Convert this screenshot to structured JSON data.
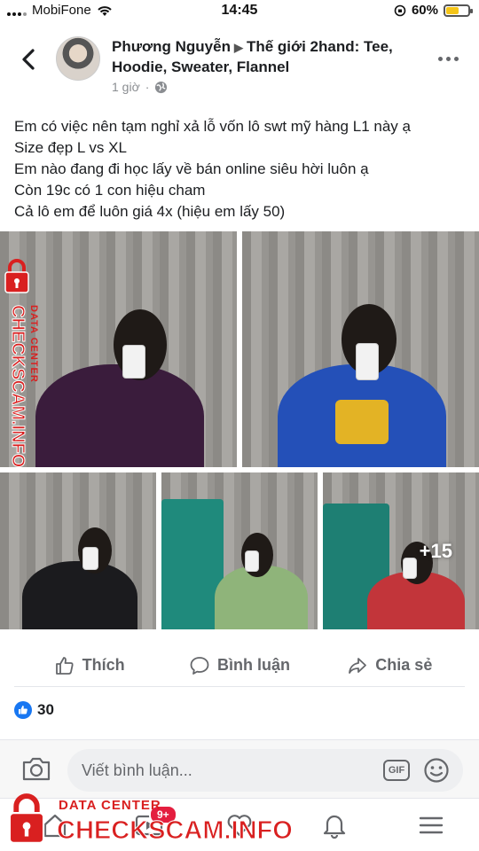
{
  "status_bar": {
    "carrier": "MobiFone",
    "time": "14:45",
    "battery_percent": "60%",
    "battery_level": 0.6
  },
  "header": {
    "author_name": "Phương Nguyễn",
    "group_name": "Thế giới 2hand: Tee, Hoodie, Sweater, Flannel",
    "time_ago": "1 giờ",
    "separator": "·"
  },
  "post": {
    "lines": [
      "Em có việc nên tạm nghỉ xả lỗ vốn lô swt mỹ hàng L1 này ạ",
      "Size đẹp L vs XL",
      "Em nào đang đi học lấy về bán online siêu hời luôn ạ",
      "Còn 19c có 1 con hiệu cham",
      "Cả lô em để luôn giá 4x (hiệu em lấy 50)"
    ],
    "more_photos": "+15"
  },
  "actions": {
    "like": "Thích",
    "comment": "Bình luận",
    "share": "Chia sẻ"
  },
  "reactions": {
    "count": "30"
  },
  "comment_bar": {
    "placeholder": "Viết bình luận...",
    "gif_label": "GIF"
  },
  "bottom_nav": {
    "video_badge": "9+"
  },
  "watermark": {
    "brand": "CHECKSCAM.INFO",
    "tag": "DATA CENTER"
  },
  "colors": {
    "accent": "#1877f2",
    "watermark_red": "#d92020",
    "badge_red": "#e41e3f",
    "muted_text": "#65676b"
  },
  "icons": {
    "back": "chevron-left-icon",
    "more": "more-horizontal-icon",
    "globe": "globe-icon",
    "like": "thumbs-up-icon",
    "comment": "comment-bubble-icon",
    "share": "share-arrow-icon",
    "camera": "camera-icon",
    "emoji": "smiley-icon",
    "lock": "lock-icon"
  }
}
